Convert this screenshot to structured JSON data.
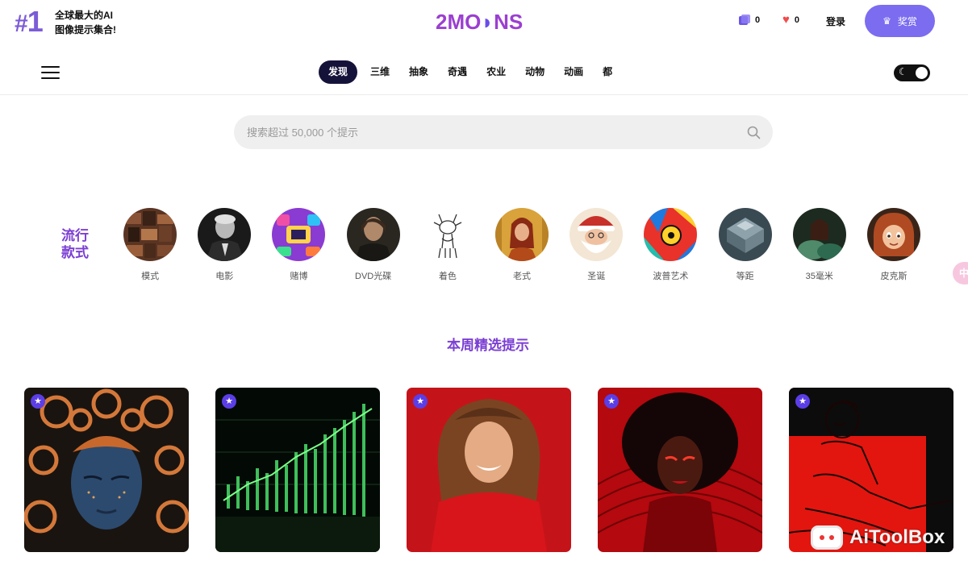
{
  "header": {
    "rank_hash": "#",
    "rank_number": "1",
    "tagline_line1": "全球最大的AI",
    "tagline_line2": "图像提示集合!",
    "logo_left": "2MO",
    "logo_moon": "◗",
    "logo_right": "NS",
    "prompts_count": "0",
    "likes_count": "0",
    "login_label": "登录",
    "reward_label": "奖赏",
    "icons": [
      "prompts-stack-icon",
      "heart-icon",
      "crown-icon"
    ]
  },
  "nav": {
    "tabs": [
      {
        "label": "发现",
        "active": true
      },
      {
        "label": "三维",
        "active": false
      },
      {
        "label": "抽象",
        "active": false
      },
      {
        "label": "奇遇",
        "active": false
      },
      {
        "label": "农业",
        "active": false
      },
      {
        "label": "动物",
        "active": false
      },
      {
        "label": "动画",
        "active": false
      },
      {
        "label": "都",
        "active": false
      }
    ],
    "theme": "dark-mode-toggle"
  },
  "search": {
    "placeholder": "搜索超过 50,000 个提示"
  },
  "popular": {
    "label_line1": "流行",
    "label_line2": "款式",
    "styles": [
      {
        "label": "模式"
      },
      {
        "label": "电影"
      },
      {
        "label": "赌博"
      },
      {
        "label": "DVD光碟"
      },
      {
        "label": "着色"
      },
      {
        "label": "老式"
      },
      {
        "label": "圣诞"
      },
      {
        "label": "波普艺术"
      },
      {
        "label": "等距"
      },
      {
        "label": "35毫米"
      },
      {
        "label": "皮克斯"
      }
    ]
  },
  "side_pill": {
    "label": "中"
  },
  "featured": {
    "title": "本周精选提示",
    "badge_glyph": "★",
    "cards": [
      {
        "name": "ornate-blue-face"
      },
      {
        "name": "green-stock-chart"
      },
      {
        "name": "smiling-woman-red"
      },
      {
        "name": "woman-red-afro"
      },
      {
        "name": "red-illustration-woman"
      }
    ]
  },
  "watermark": {
    "text": "AiToolBox"
  },
  "colors": {
    "brand_purple": "#7b3fd3",
    "reward_button": "#7b6cf0",
    "active_tab": "#15123a",
    "search_bg": "#efefef"
  }
}
